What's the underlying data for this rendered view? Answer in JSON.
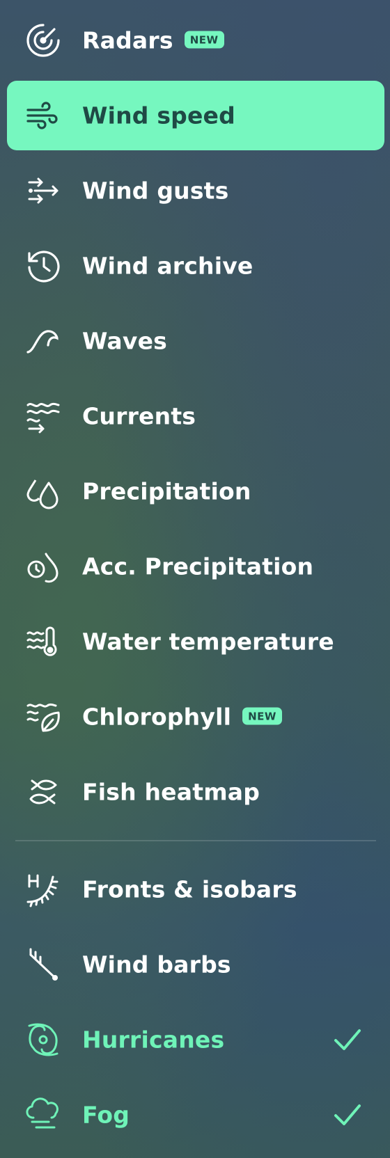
{
  "menu": {
    "badge_new": "NEW",
    "accent_color": "#76f7bf",
    "items": [
      {
        "label": "Radars",
        "icon": "radar-icon",
        "badge": true
      },
      {
        "label": "Wind speed",
        "icon": "wind-icon",
        "active": true
      },
      {
        "label": "Wind gusts",
        "icon": "wind-gusts-icon"
      },
      {
        "label": "Wind archive",
        "icon": "history-icon"
      },
      {
        "label": "Waves",
        "icon": "wave-icon"
      },
      {
        "label": "Currents",
        "icon": "currents-icon"
      },
      {
        "label": "Precipitation",
        "icon": "droplets-icon"
      },
      {
        "label": "Acc. Precipitation",
        "icon": "clock-drop-icon"
      },
      {
        "label": "Water temperature",
        "icon": "thermometer-waves-icon"
      },
      {
        "label": "Chlorophyll",
        "icon": "leaf-waves-icon",
        "badge": true
      },
      {
        "label": "Fish heatmap",
        "icon": "fish-icon"
      },
      {
        "label": "Fronts & isobars",
        "icon": "fronts-icon"
      },
      {
        "label": "Wind barbs",
        "icon": "wind-barb-icon"
      },
      {
        "label": "Hurricanes",
        "icon": "hurricane-icon",
        "checked": true
      },
      {
        "label": "Fog",
        "icon": "fog-icon",
        "checked": true
      }
    ]
  }
}
